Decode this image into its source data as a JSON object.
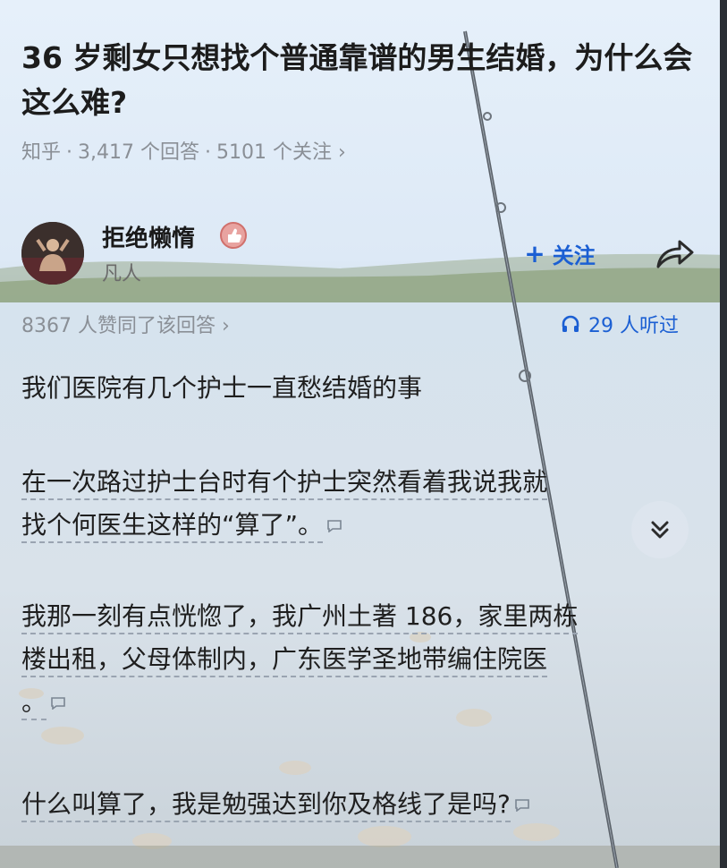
{
  "question": {
    "title": "36 岁剩女只想找个普通靠谱的男生结婚，为什么会这么难?",
    "source": "知乎",
    "answers": "3,417 个回答",
    "followers": "5101 个关注 ›"
  },
  "author": {
    "name": "拒绝懒惰",
    "bio": "凡人",
    "follow_label": "关注",
    "follow_plus": "+"
  },
  "answer_stats": {
    "votes": "8367 人赞同了该回答 ›",
    "listens": "29 人听过"
  },
  "paragraphs": {
    "p1": "我们医院有几个护士一直愁结婚的事",
    "p2_line1": "在一次路过护士台时有个护士突然看着我说我就",
    "p2_line2": "找个何医生这样的“算了”。",
    "p3_line1": "我那一刻有点恍惚了，我广州土著 186，家里两栋",
    "p3_line2": "楼出租，父母体制内，广东医学圣地带编住院医",
    "p3_line3": "。",
    "p4": "什么叫算了，我是勉强达到你及格线了是吗?"
  },
  "icons": {
    "badge": "thumb-badge-icon",
    "share": "share-arrow-icon",
    "headphones": "headphones-icon",
    "expand": "chevron-double-down-icon",
    "comment": "comment-bubble-icon"
  },
  "colors": {
    "accent": "#1b5fd3",
    "muted": "#8a8f96"
  }
}
